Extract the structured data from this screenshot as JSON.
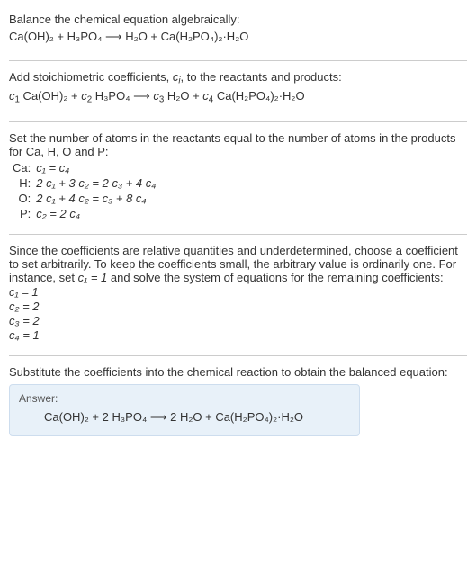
{
  "sec1": {
    "line1": "Balance the chemical equation algebraically:",
    "eqn": "Ca(OH)₂ + H₃PO₄  ⟶  H₂O + Ca(H₂PO₄)₂·H₂O"
  },
  "sec2": {
    "line1_a": "Add stoichiometric coefficients, ",
    "ci_c": "c",
    "ci_i": "i",
    "line1_b": ", to the reactants and products:",
    "eqn_a": "c",
    "s1": "1",
    "sp1": " Ca(OH)₂ + ",
    "s2": "2",
    "sp2": " H₃PO₄  ⟶  ",
    "s3": "3",
    "sp3": " H₂O + ",
    "s4": "4",
    "sp4": " Ca(H₂PO₄)₂·H₂O"
  },
  "sec3": {
    "line1": "Set the number of atoms in the reactants equal to the number of atoms in the products for Ca, H, O and P:",
    "rows": {
      "r0": {
        "elem": "Ca:",
        "eq": "c₁ = c₄"
      },
      "r1": {
        "elem": "H:",
        "eq": "2 c₁ + 3 c₂ = 2 c₃ + 4 c₄"
      },
      "r2": {
        "elem": "O:",
        "eq": "2 c₁ + 4 c₂ = c₃ + 8 c₄"
      },
      "r3": {
        "elem": "P:",
        "eq": "c₂ = 2 c₄"
      }
    }
  },
  "sec4": {
    "para_a": "Since the coefficients are relative quantities and underdetermined, choose a coefficient to set arbitrarily. To keep the coefficients small, the arbitrary value is ordinarily one. For instance, set ",
    "c1": "c₁ = 1",
    "para_b": " and solve the system of equations for the remaining coefficients:",
    "l1": "c₁ = 1",
    "l2": "c₂ = 2",
    "l3": "c₃ = 2",
    "l4": "c₄ = 1"
  },
  "sec5": {
    "line1": "Substitute the coefficients into the chemical reaction to obtain the balanced equation:",
    "answer_label": "Answer:",
    "answer_eqn": "Ca(OH)₂ + 2 H₃PO₄  ⟶  2 H₂O + Ca(H₂PO₄)₂·H₂O"
  }
}
